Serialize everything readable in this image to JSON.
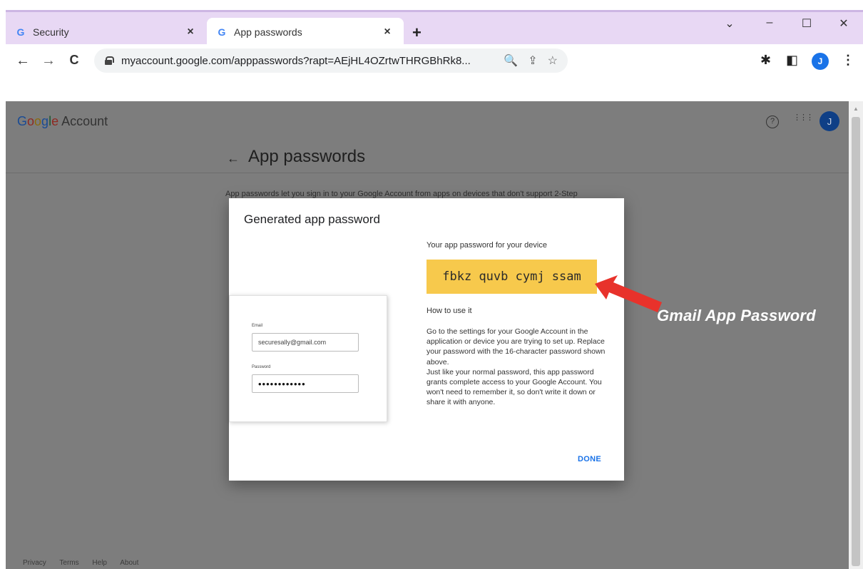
{
  "browser": {
    "tabs": [
      {
        "icon": "G",
        "title": "Security",
        "close": "×"
      },
      {
        "icon": "G",
        "title": "App passwords",
        "close": "×"
      }
    ],
    "new_tab": "+",
    "window_controls": {
      "dropdown": "⌄",
      "minimize": "–",
      "maximize": "☐",
      "close": "✕"
    },
    "nav": {
      "back": "←",
      "forward": "→",
      "reload": "C"
    },
    "url": "myaccount.google.com/apppasswords?rapt=AEjHL4OZrtwTHRGBhRk8...",
    "omnibox_icons": {
      "zoom": "🔍",
      "share": "⇪",
      "bookmark": "☆"
    },
    "extensions": {
      "puzzle": "✱",
      "sidepanel": "◧",
      "menu": "⋮"
    },
    "profile_initial": "J"
  },
  "header": {
    "brand_google": [
      "G",
      "o",
      "o",
      "g",
      "l",
      "e"
    ],
    "brand_account": "Account",
    "help_icon": "?",
    "apps_icon": "⋮⋮⋮",
    "avatar_initial": "J"
  },
  "page": {
    "back_arrow": "←",
    "title": "App passwords",
    "description": "App passwords let you sign in to your Google Account from apps on devices that don't support 2-Step"
  },
  "dialog": {
    "title": "Generated app password",
    "mock_form": {
      "email_label": "Email",
      "email_value": "securesally@gmail.com",
      "password_label": "Password",
      "password_value": "••••••••••••"
    },
    "password_label": "Your app password for your device",
    "password": "fbkz quvb cymj ssam",
    "howto_title": "How to use it",
    "instructions_1": "Go to the settings for your Google Account in the application or device you are trying to set up. Replace your password with the 16-character password shown above.",
    "instructions_2": "Just like your normal password, this app password grants complete access to your Google Account. You won't need to remember it, so don't write it down or share it with anyone.",
    "done_label": "DONE"
  },
  "annotation": "Gmail App Password",
  "footer": [
    "Privacy",
    "Terms",
    "Help",
    "About"
  ],
  "colors": {
    "password_highlight": "#f7c94c",
    "link_blue": "#1a73e8",
    "arrow_red": "#e8322b",
    "tab_strip": "#e8d8f4"
  }
}
